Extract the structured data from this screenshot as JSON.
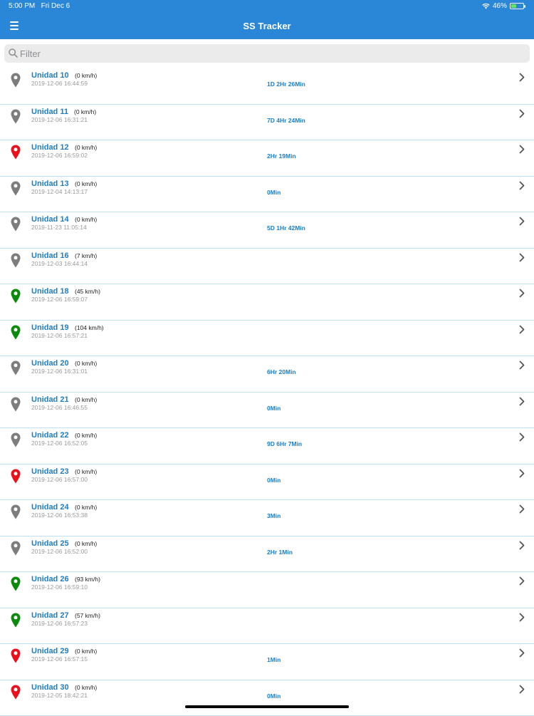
{
  "status_bar": {
    "time": "5:00 PM",
    "date": "Fri Dec 6",
    "battery": "46%",
    "battery_level": 0.46
  },
  "header": {
    "title": "SS Tracker"
  },
  "search": {
    "placeholder": "Filter"
  },
  "colors": {
    "header": "#2a86d6",
    "link": "#1a7ec8",
    "gray_pin": "#7d7d7d",
    "red_pin": "#e8111c",
    "green_pin": "#0b8a0b"
  },
  "units": [
    {
      "name": "Unidad 10",
      "speed": "(0 km/h)",
      "date": "2019-12-06 16:44:59",
      "duration": "1D 2Hr 26Min",
      "pin_color": "gray"
    },
    {
      "name": "Unidad 11",
      "speed": "(0 km/h)",
      "date": "2019-12-06 16:31:21",
      "duration": "7D 4Hr 24Min",
      "pin_color": "gray"
    },
    {
      "name": "Unidad 12",
      "speed": "(0 km/h)",
      "date": "2019-12-06 16:59:02",
      "duration": "2Hr 19Min",
      "pin_color": "red"
    },
    {
      "name": "Unidad 13",
      "speed": "(0 km/h)",
      "date": "2019-12-04 14:13:17",
      "duration": "0Min",
      "pin_color": "gray"
    },
    {
      "name": "Unidad 14",
      "speed": "(0 km/h)",
      "date": "2019-11-23 11:05:14",
      "duration": "5D 1Hr 42Min",
      "pin_color": "gray"
    },
    {
      "name": "Unidad 16",
      "speed": "(7 km/h)",
      "date": "2019-12-03 16:44:14",
      "duration": "",
      "pin_color": "gray"
    },
    {
      "name": "Unidad 18",
      "speed": "(45 km/h)",
      "date": "2019-12-06 16:59:07",
      "duration": "",
      "pin_color": "green"
    },
    {
      "name": "Unidad 19",
      "speed": "(104 km/h)",
      "date": "2019-12-06 16:57:21",
      "duration": "",
      "pin_color": "green"
    },
    {
      "name": "Unidad 20",
      "speed": "(0 km/h)",
      "date": "2019-12-06 16:31:01",
      "duration": "6Hr 20Min",
      "pin_color": "gray"
    },
    {
      "name": "Unidad 21",
      "speed": "(0 km/h)",
      "date": "2019-12-06 16:46:55",
      "duration": "0Min",
      "pin_color": "gray"
    },
    {
      "name": "Unidad 22",
      "speed": "(0 km/h)",
      "date": "2019-12-06 16:52:05",
      "duration": "9D 6Hr 7Min",
      "pin_color": "gray"
    },
    {
      "name": "Unidad 23",
      "speed": "(0 km/h)",
      "date": "2019-12-06 16:57:00",
      "duration": "0Min",
      "pin_color": "red"
    },
    {
      "name": "Unidad 24",
      "speed": "(0 km/h)",
      "date": "2019-12-06 16:53:38",
      "duration": "3Min",
      "pin_color": "gray"
    },
    {
      "name": "Unidad 25",
      "speed": "(0 km/h)",
      "date": "2019-12-06 16:52:00",
      "duration": "2Hr 1Min",
      "pin_color": "gray"
    },
    {
      "name": "Unidad 26",
      "speed": "(93 km/h)",
      "date": "2019-12-06 16:59:10",
      "duration": "",
      "pin_color": "green"
    },
    {
      "name": "Unidad 27",
      "speed": "(57 km/h)",
      "date": "2019-12-06 16:57:23",
      "duration": "",
      "pin_color": "green"
    },
    {
      "name": "Unidad 29",
      "speed": "(0 km/h)",
      "date": "2019-12-06 16:57:15",
      "duration": "1Min",
      "pin_color": "red"
    },
    {
      "name": "Unidad 30",
      "speed": "(0 km/h)",
      "date": "2019-12-05 18:42:21",
      "duration": "0Min",
      "pin_color": "red"
    }
  ]
}
